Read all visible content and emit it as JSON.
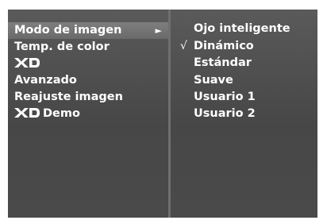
{
  "left_menu": {
    "items": [
      {
        "label": "Modo de imagen",
        "selected": true,
        "has_submenu_arrow": true
      },
      {
        "label": "Temp. de color"
      },
      {
        "label": "XD",
        "icon": "xd-logo-icon"
      },
      {
        "label": "Avanzado"
      },
      {
        "label": "Reajuste imagen"
      },
      {
        "label": "Demo",
        "icon": "xd-logo-icon"
      }
    ],
    "submenu_arrow": "►"
  },
  "right_menu": {
    "check_glyph": "√",
    "items": [
      {
        "label": "Ojo inteligente",
        "checked": false
      },
      {
        "label": "Dinámico",
        "checked": true
      },
      {
        "label": "Estándar",
        "checked": false
      },
      {
        "label": "Suave",
        "checked": false
      },
      {
        "label": "Usuario 1",
        "checked": false
      },
      {
        "label": "Usuario 2",
        "checked": false
      }
    ]
  },
  "colors": {
    "background": "#ffffff",
    "panel": "#4a4a4a",
    "highlight": "#757575",
    "text": "#ffffff"
  }
}
